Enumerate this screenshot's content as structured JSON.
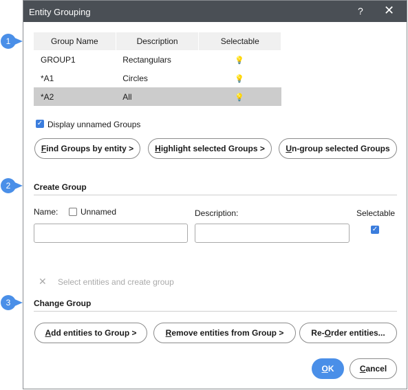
{
  "window": {
    "title": "Entity Grouping",
    "help": "?",
    "close": "✕"
  },
  "table": {
    "columns": [
      "Group Name",
      "Description",
      "Selectable"
    ],
    "rows": [
      {
        "name": "GROUP1",
        "description": "Rectangulars",
        "selectable_icon": "lightbulb-on-icon",
        "selected": false
      },
      {
        "name": "*A1",
        "description": "Circles",
        "selectable_icon": "lightbulb-off-icon",
        "selected": false
      },
      {
        "name": "*A2",
        "description": "All",
        "selectable_icon": "lightbulb-off-icon",
        "selected": true
      }
    ]
  },
  "display_unnamed": {
    "label": "Display unnamed Groups",
    "checked": true
  },
  "group_actions": {
    "find_u": "F",
    "find_rest": "ind Groups by entity >",
    "highlight_u": "H",
    "highlight_rest": "ighlight selected Groups >",
    "ungroup_u": "U",
    "ungroup_rest": "n-group selected Groups"
  },
  "create_group": {
    "heading": "Create Group",
    "name_label": "Name:",
    "unnamed_label": "Unnamed",
    "unnamed_checked": false,
    "description_label": "Description:",
    "selectable_label": "Selectable",
    "selectable_checked": true,
    "name_value": "",
    "description_value": "",
    "create_label": "Select entities and create group"
  },
  "change_group": {
    "heading": "Change Group",
    "add_u": "A",
    "add_rest": "dd entities to Group >",
    "remove_u": "R",
    "remove_rest": "emove entities from Group >",
    "reorder_pre": "Re-",
    "reorder_u": "O",
    "reorder_rest": "rder entities..."
  },
  "footer": {
    "ok_u": "O",
    "ok_rest": "K",
    "cancel_u": "C",
    "cancel_rest": "ancel"
  },
  "callouts": [
    "1",
    "2",
    "3"
  ],
  "colors": {
    "accent": "#4a8fe8",
    "titlebar": "#4a4f55",
    "selected_row": "#cccccc"
  }
}
